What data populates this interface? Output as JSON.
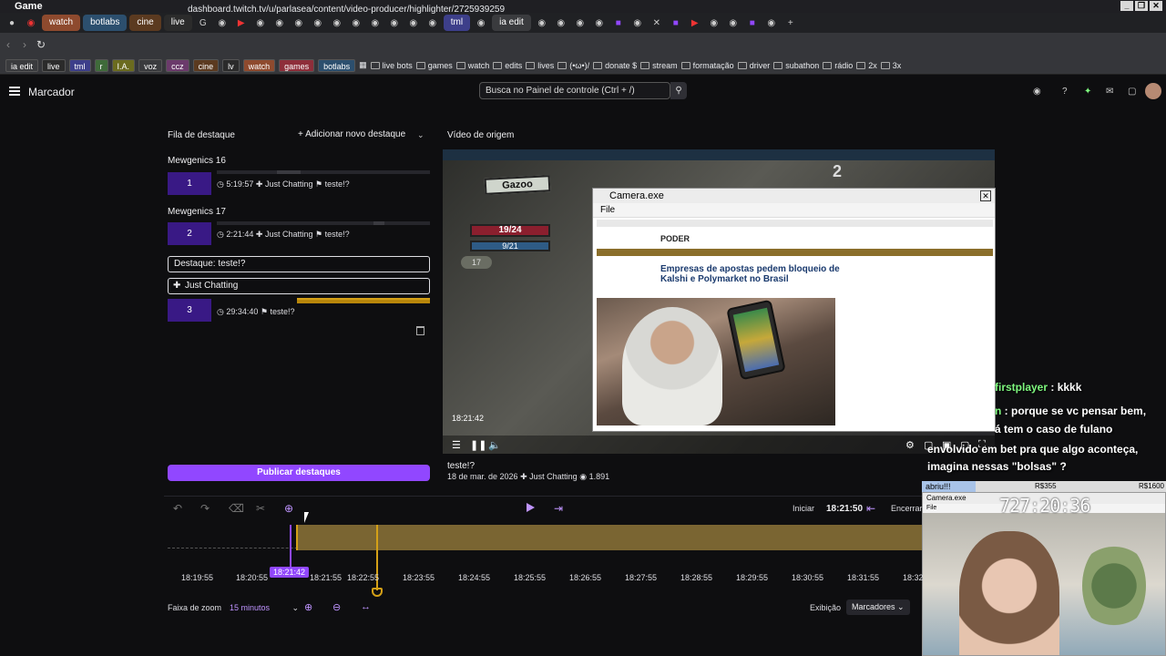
{
  "window": {
    "title": "Game"
  },
  "tabs": [
    {
      "label": "watch",
      "color": "#8e4a2e"
    },
    {
      "label": "botlabs",
      "color": "#2c4f6e"
    },
    {
      "label": "cine",
      "color": "#5b3a20"
    },
    {
      "label": "live",
      "color": "#2b2b2b"
    },
    {
      "label": "tml",
      "color": "#3d3f8a"
    },
    {
      "label": "ia edit",
      "color": "#3a3b3e"
    }
  ],
  "address": {
    "url": "dashboard.twitch.tv/u/parlasea/content/video-producer/highlighter/2725939259"
  },
  "bookmarks": {
    "chips": [
      {
        "label": "ia edit",
        "color": "#3a3b3e"
      },
      {
        "label": "live",
        "color": "#2b2b2b"
      },
      {
        "label": "tml",
        "color": "#3d3f8a"
      },
      {
        "label": "r",
        "color": "#3f6b3a"
      },
      {
        "label": "I.A.",
        "color": "#6b6b1f"
      },
      {
        "label": "voz",
        "color": "#3a3b3e"
      },
      {
        "label": "ccz",
        "color": "#6b3a6b"
      },
      {
        "label": "cine",
        "color": "#5b3a20"
      },
      {
        "label": "lv",
        "color": "#2b2b2b"
      },
      {
        "label": "watch",
        "color": "#8e4a2e"
      },
      {
        "label": "games",
        "color": "#8e2e3a"
      },
      {
        "label": "botlabs",
        "color": "#2c4f6e"
      }
    ],
    "items": [
      "live bots",
      "games",
      "watch",
      "edits",
      "lives",
      "(•ω•)/",
      "donate $",
      "stream",
      "formatação",
      "driver",
      "subathon",
      "rádio",
      "2x",
      "3x"
    ]
  },
  "header": {
    "title": "Marcador",
    "search_placeholder": "Busca no Painel de controle (Ctrl + /)",
    "notif_count": "1"
  },
  "queue": {
    "title": "Fila de destaque",
    "add_label": "Adicionar novo destaque",
    "items": [
      {
        "name": "Mewgenics 16",
        "num": "1",
        "duration": "5:19:57",
        "category": "Just Chatting",
        "tag": "teste!?"
      },
      {
        "name": "Mewgenics 17",
        "num": "2",
        "duration": "2:21:44",
        "category": "Just Chatting",
        "tag": "teste!?"
      }
    ],
    "editing": {
      "title_value": "Destaque: teste!?",
      "category_value": "Just Chatting",
      "num": "3",
      "duration": "29:34:40",
      "tag": "teste!?"
    },
    "publish_label": "Publicar destaques"
  },
  "source": {
    "title": "Vídeo de origem",
    "video_title": "teste!?",
    "date": "18 de mar. de 2026",
    "category": "Just Chatting",
    "views": "1.891",
    "timestamp": "18:21:42"
  },
  "game_hud": {
    "name": "Gazoo",
    "hp": "19/24",
    "mp": "9/21",
    "level": "17",
    "round": "2"
  },
  "camera_window": {
    "title": "Camera.exe",
    "menu": "File"
  },
  "webpage": {
    "logo": "PODER",
    "headline": "Empresas de apostas pedem bloqueio de Kalshi e Polymarket no Brasil"
  },
  "chat": [
    {
      "user": "firstplayer",
      "text": " : kkkk"
    },
    {
      "user": "n",
      "text": " : porque se vc pensar bem,"
    },
    {
      "user": "",
      "text": "á tem o caso de fulano"
    },
    {
      "user": "",
      "text": "envolvido em bet pra que algo aconteça,"
    },
    {
      "user": "",
      "text": "imagina nessas \"bolsas\" ?"
    }
  ],
  "overlay": {
    "label": "abriu!!!",
    "v1": "R$355",
    "v2": "R$1600",
    "progress": 0.22
  },
  "cam2": {
    "title": "Camera.exe",
    "menu": "File",
    "clock": "727:20:36"
  },
  "timeline": {
    "start_label": "Iniciar",
    "start_time": "18:21:50",
    "end_label": "Encerrar",
    "cursor_time": "18:21:42",
    "ticks": [
      "18:19:55",
      "18:20:55",
      "18:21:55",
      "18:22:55",
      "18:23:55",
      "18:24:55",
      "18:25:55",
      "18:26:55",
      "18:27:55",
      "18:28:55",
      "18:29:55",
      "18:30:55",
      "18:31:55",
      "18:32"
    ]
  },
  "footer": {
    "zoom_label": "Faixa de zoom",
    "zoom_value": "15 minutos",
    "display_label": "Exibição",
    "display_value": "Marcadores"
  }
}
